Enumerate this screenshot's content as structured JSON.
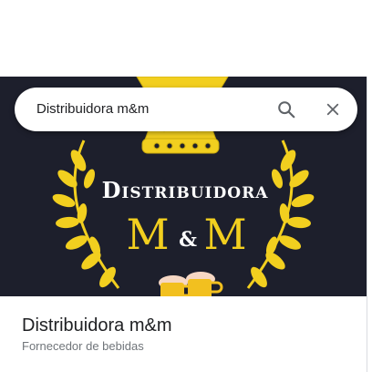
{
  "search": {
    "query": "Distribuidora m&m"
  },
  "icons": {
    "search": "search-icon",
    "close": "close-icon",
    "crown": "crown-icon",
    "beer": "beer-mugs-icon"
  },
  "logo": {
    "line1": "Distribuidora",
    "line2_left": "M",
    "line2_amp": "&",
    "line2_right": "M"
  },
  "place": {
    "name": "Distribuidora m&m",
    "category": "Fornecedor de bebidas"
  },
  "colors": {
    "logo_background": "#1d1f2c",
    "logo_gold": "#f2cf1f",
    "logo_text": "#ffffff",
    "category_text": "#70757a"
  }
}
